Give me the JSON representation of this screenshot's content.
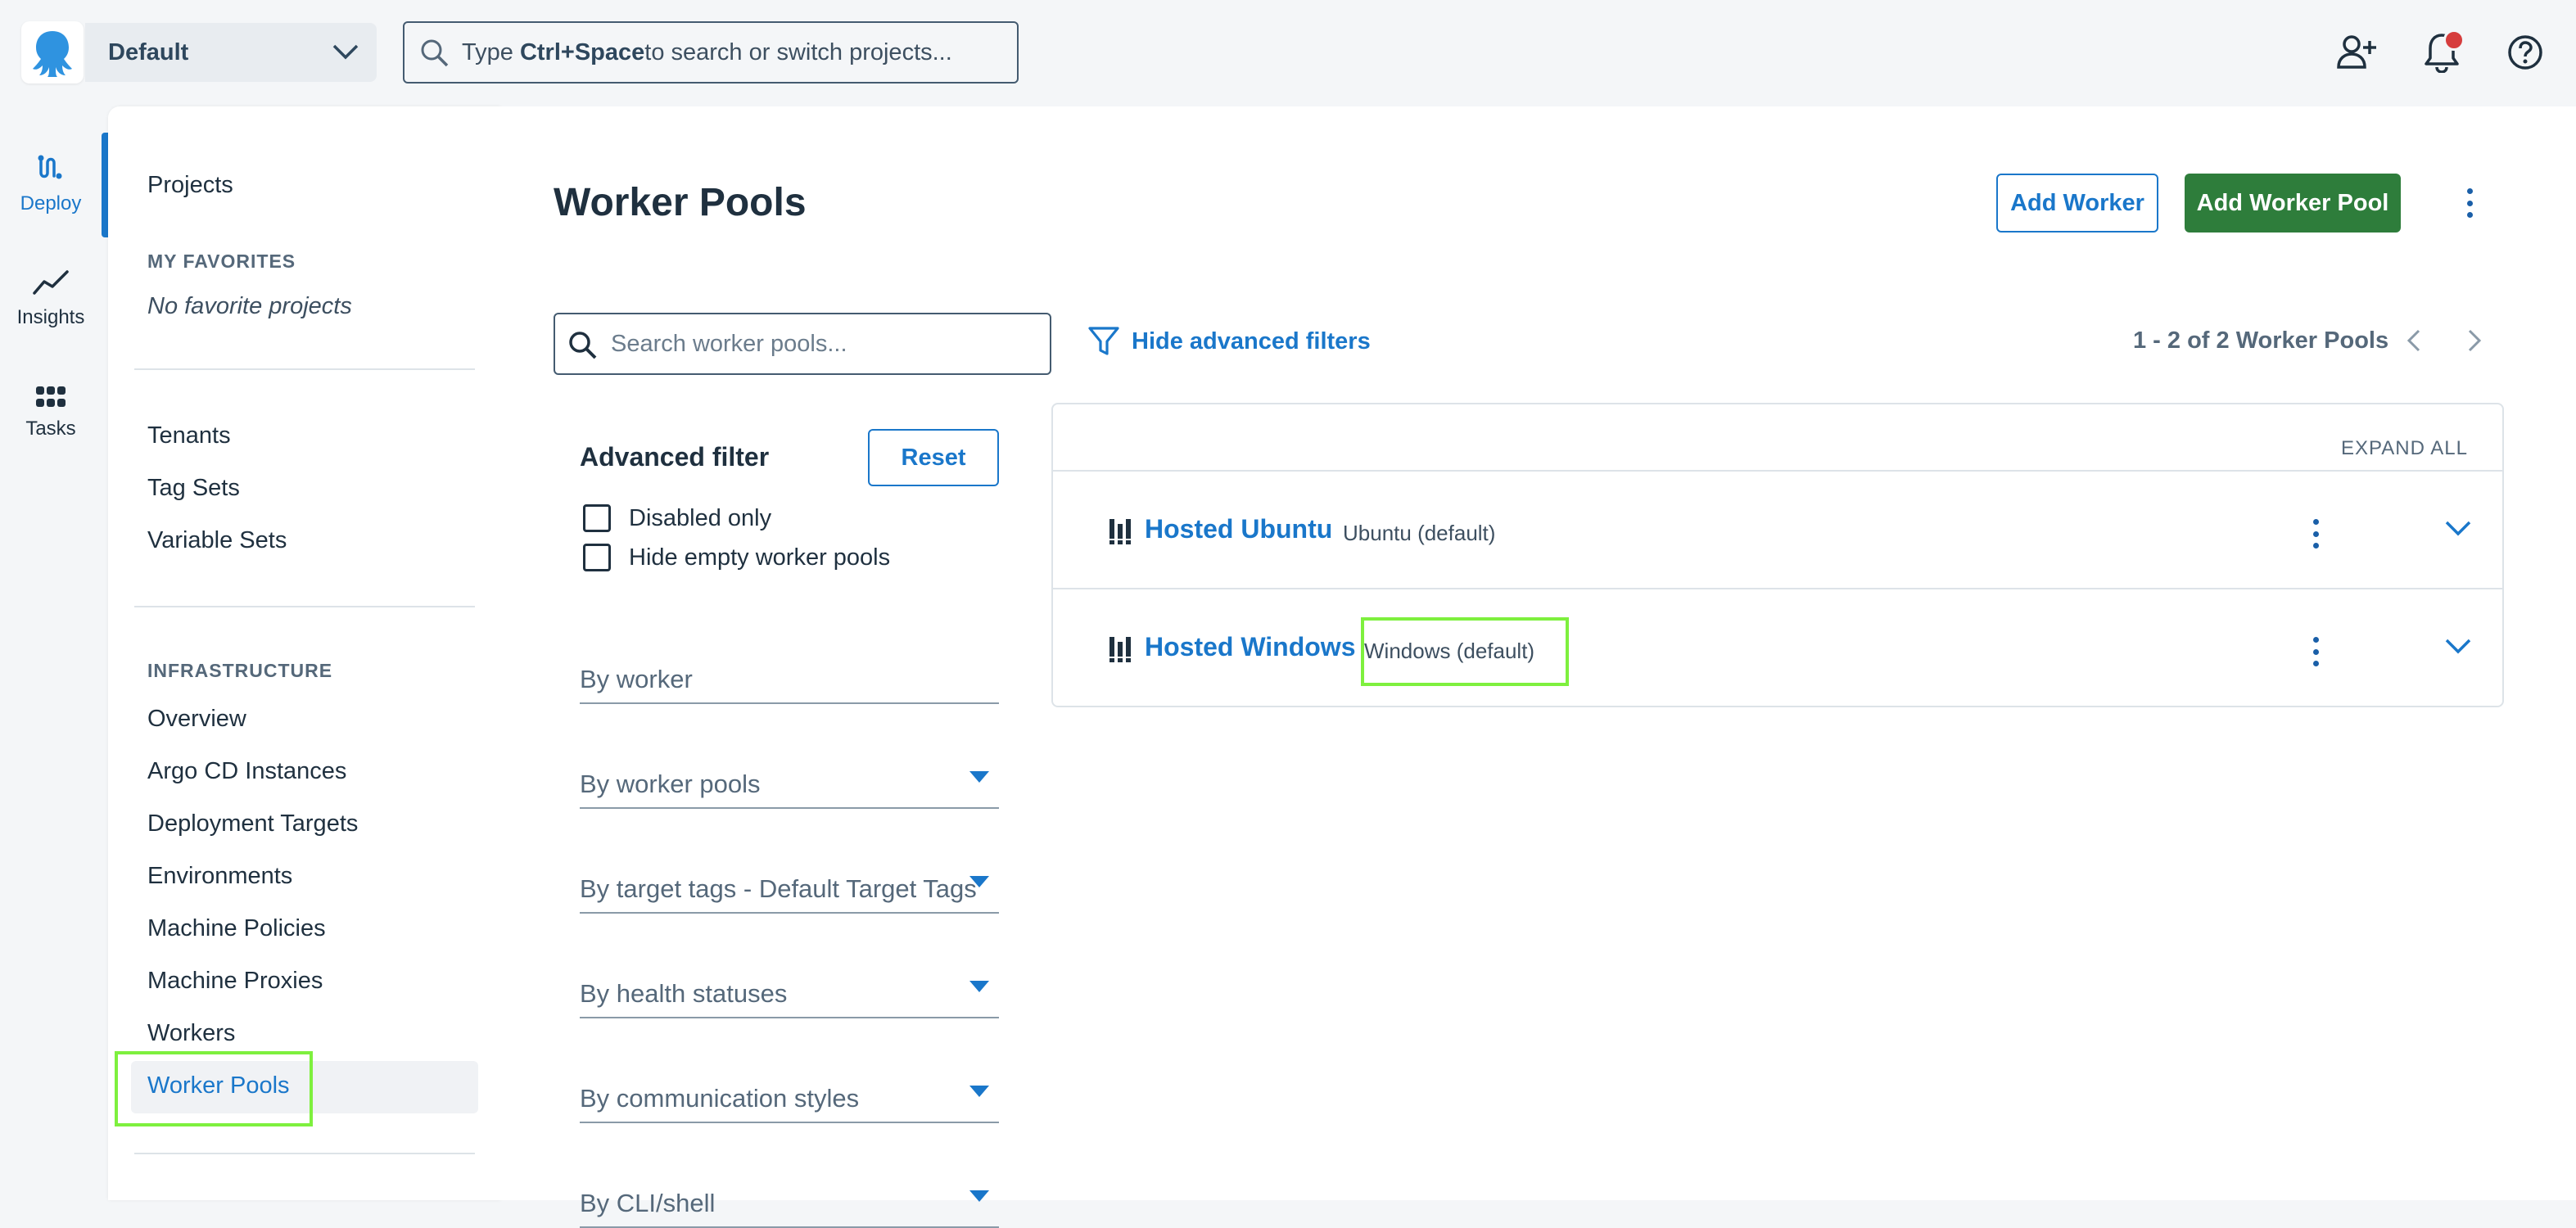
{
  "topbar": {
    "space_name": "Default",
    "search_prefix": "Type ",
    "search_key": "Ctrl+Space",
    "search_suffix": " to search or switch projects..."
  },
  "rail": {
    "items": [
      {
        "label": "Deploy",
        "icon": "deploy-icon",
        "active": true
      },
      {
        "label": "Insights",
        "icon": "insights-icon"
      },
      {
        "label": "Tasks",
        "icon": "tasks-icon"
      }
    ]
  },
  "subnav": {
    "projects": "Projects",
    "favorites_header": "MY FAVORITES",
    "no_favorites": "No favorite projects",
    "tenants": "Tenants",
    "tag_sets": "Tag Sets",
    "variable_sets": "Variable Sets",
    "infra_header": "INFRASTRUCTURE",
    "infra_items": [
      "Overview",
      "Argo CD Instances",
      "Deployment Targets",
      "Environments",
      "Machine Policies",
      "Machine Proxies",
      "Workers",
      "Worker Pools"
    ]
  },
  "main": {
    "title": "Worker Pools",
    "add_worker": "Add Worker",
    "add_worker_pool": "Add Worker Pool",
    "search_placeholder": "Search worker pools...",
    "hide_filters": "Hide advanced filters",
    "pager": "1 - 2 of 2 Worker Pools"
  },
  "filters": {
    "title": "Advanced filter",
    "reset": "Reset",
    "disabled_only": "Disabled only",
    "hide_empty": "Hide empty worker pools",
    "by_worker": "By worker",
    "by_worker_pools": "By worker pools",
    "by_target_tags": "By target tags - Default Target Tags",
    "by_health": "By health statuses",
    "by_comm": "By communication styles",
    "by_cli": "By CLI/shell"
  },
  "pools": {
    "expand_all": "EXPAND ALL",
    "rows": [
      {
        "name": "Hosted Ubuntu",
        "type": "Ubuntu (default)"
      },
      {
        "name": "Hosted Windows",
        "type": "Windows (default)"
      }
    ]
  },
  "colors": {
    "accent": "#1a77ca",
    "primary_button": "#2e7d3b",
    "notification": "#d63d3d",
    "highlight_box": "#7ef03e"
  }
}
